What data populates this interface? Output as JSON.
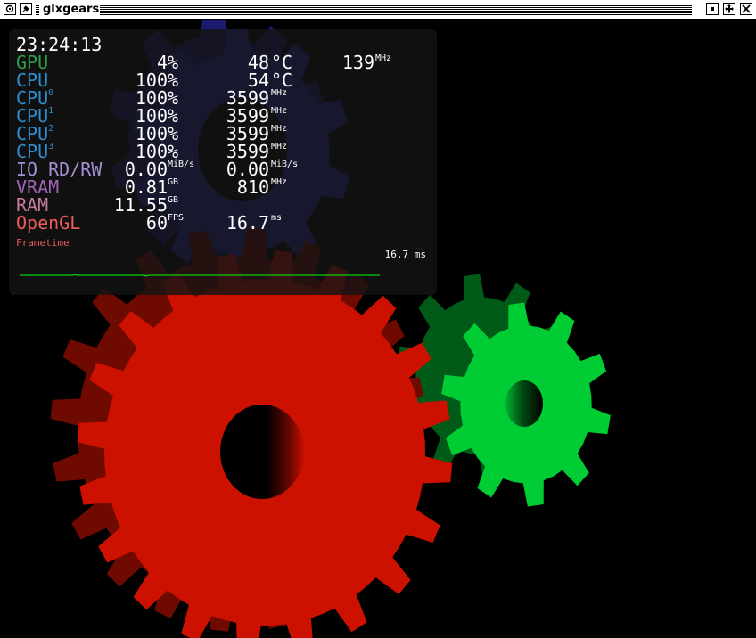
{
  "window": {
    "title": "glxgears"
  },
  "colors": {
    "red_gear": "#cc1100",
    "green_gear": "#00cc33",
    "blue_gear": "#2a2a9e",
    "gpu_label": "#2e9e4a",
    "cpu_label": "#2d8fd0",
    "io_label": "#a48fd6",
    "vram_label": "#a364b8",
    "ram_label": "#c27b9a",
    "opengl_label": "#eb5b5b",
    "frametime_label": "#eb5b5b",
    "graph_line": "#00ff00"
  },
  "hud": {
    "time": "23:24:13",
    "gpu": {
      "label": "GPU",
      "load": "4",
      "load_unit": "%",
      "temp": "48",
      "temp_unit": "°C",
      "clock": "139",
      "clock_unit": "MHz"
    },
    "cpu": {
      "label": "CPU",
      "load": "100",
      "load_unit": "%",
      "temp": "54",
      "temp_unit": "°C"
    },
    "cores": [
      {
        "label": "CPU",
        "index": "0",
        "load": "100",
        "load_unit": "%",
        "clock": "3599",
        "clock_unit": "MHz"
      },
      {
        "label": "CPU",
        "index": "1",
        "load": "100",
        "load_unit": "%",
        "clock": "3599",
        "clock_unit": "MHz"
      },
      {
        "label": "CPU",
        "index": "2",
        "load": "100",
        "load_unit": "%",
        "clock": "3599",
        "clock_unit": "MHz"
      },
      {
        "label": "CPU",
        "index": "3",
        "load": "100",
        "load_unit": "%",
        "clock": "3599",
        "clock_unit": "MHz"
      }
    ],
    "io": {
      "label": "IO RD/RW",
      "read": "0.00",
      "read_unit": "MiB/s",
      "write": "0.00",
      "write_unit": "MiB/s"
    },
    "vram": {
      "label": "VRAM",
      "used": "0.81",
      "used_unit": "GB",
      "clock": "810",
      "clock_unit": "MHz"
    },
    "ram": {
      "label": "RAM",
      "used": "11.55",
      "used_unit": "GB"
    },
    "opengl": {
      "label": "OpenGL",
      "fps": "60",
      "fps_unit": "FPS",
      "frametime": "16.7",
      "frametime_unit": "ms"
    },
    "frametime": {
      "label": "Frametime",
      "value": "16.7 ms"
    }
  }
}
